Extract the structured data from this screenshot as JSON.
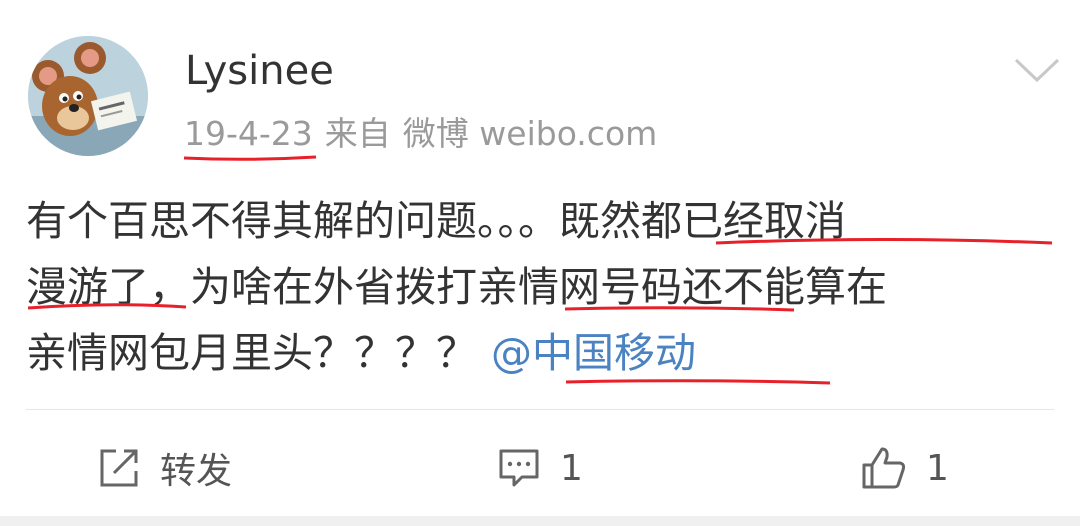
{
  "post": {
    "username": "Lysinee",
    "date": "19-4-23",
    "source_prefix": "来自",
    "source": "微博 weibo.com",
    "text_line1": "有个百思不得其解的问题。。。既然都已经取消",
    "text_line2": "漫游了，为啥在外省拨打亲情网号码还不能算在",
    "text_line3": "亲情网包月里头？？？？",
    "mention": "@中国移动"
  },
  "actions": {
    "repost_label": "转发",
    "comment_count": "1",
    "like_count": "1"
  },
  "colors": {
    "mention": "#4a82c2",
    "annotation_underline": "#e8202a",
    "meta_text": "#9a9a9a"
  },
  "icons": [
    "avatar-image",
    "chevron-down-icon",
    "repost-icon",
    "comment-icon",
    "like-icon"
  ]
}
